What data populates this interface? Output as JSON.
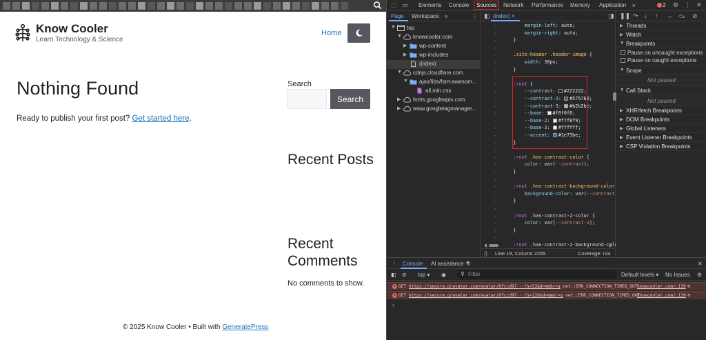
{
  "site": {
    "brand_title": "Know Cooler",
    "brand_tagline": "Learn Technology & Science",
    "nav_home": "Home",
    "page_title": "Nothing Found",
    "page_text": "Ready to publish your first post? ",
    "page_link": "Get started here",
    "page_text_end": ".",
    "search_label": "Search",
    "search_button": "Search",
    "recent_posts_title": "Recent Posts",
    "recent_comments_title": "Recent Comments",
    "no_comments": "No comments to show.",
    "footer_text": "© 2025 Know Cooler • Built with ",
    "footer_link": "GeneratePress"
  },
  "devtools": {
    "tabs": [
      "Elements",
      "Console",
      "Sources",
      "Network",
      "Performance",
      "Memory",
      "Application"
    ],
    "active_tab": "Sources",
    "more_tabs": "»",
    "error_count": "2",
    "navigator": {
      "tabs": [
        "Page",
        "Workspace"
      ],
      "more": "»",
      "tree": [
        {
          "label": "top",
          "type": "frame",
          "level": 0,
          "expanded": true
        },
        {
          "label": "knowcooler.com",
          "type": "cloud",
          "level": 1,
          "expanded": true
        },
        {
          "label": "wp-content",
          "type": "folder",
          "level": 2,
          "expanded": false
        },
        {
          "label": "wp-includes",
          "type": "folder",
          "level": 2,
          "expanded": false
        },
        {
          "label": "(index)",
          "type": "file",
          "level": 2,
          "selected": true
        },
        {
          "label": "cdnjs.cloudflare.com",
          "type": "cloud",
          "level": 1,
          "expanded": true
        },
        {
          "label": "ajax/libs/font-awesom...",
          "type": "folder",
          "level": 2,
          "expanded": true
        },
        {
          "label": "all.min.css",
          "type": "css",
          "level": 3
        },
        {
          "label": "fonts.googleapis.com",
          "type": "cloud",
          "level": 1,
          "expanded": false
        },
        {
          "label": "www.googletagmanager...",
          "type": "cloud",
          "level": 1,
          "expanded": false
        }
      ]
    },
    "editor": {
      "tab": "(index)",
      "status_position": "Line 19, Column 2265",
      "status_coverage": "Coverage: n/a",
      "code": [
        {
          "t": "        margin-left: auto;"
        },
        {
          "t": "        margin-right: auto;"
        },
        {
          "t": "    }"
        },
        {
          "t": ""
        },
        {
          "t": "    .site-header .header-image {"
        },
        {
          "t": "        width: 30px;"
        },
        {
          "t": "    }"
        },
        {
          "t": ""
        },
        {
          "t": "    :root {"
        },
        {
          "t": "        --contrast: ",
          "swatch": "#222222",
          "v": "#222222;"
        },
        {
          "t": "        --contrast-2: ",
          "swatch": "#575760",
          "v": "#575760;"
        },
        {
          "t": "        --contrast-3: ",
          "swatch": "#b2b2be",
          "v": "#b2b2be;"
        },
        {
          "t": "        --base: ",
          "swatch": "#f0f0f0",
          "v": "#f0f0f0;"
        },
        {
          "t": "        --base-2: ",
          "swatch": "#f7f8f9",
          "v": "#f7f8f9;"
        },
        {
          "t": "        --base-3: ",
          "swatch": "#ffffff",
          "v": "#ffffff;"
        },
        {
          "t": "        --accent: ",
          "swatch": "#1e73be",
          "v": "#1e73be;"
        },
        {
          "t": "    }"
        },
        {
          "t": ""
        },
        {
          "t": "    :root .has-contrast-color {"
        },
        {
          "t": "        color: var(--contrast);"
        },
        {
          "t": "    }"
        },
        {
          "t": ""
        },
        {
          "t": "    :root .has-contrast-background-color {"
        },
        {
          "t": "        background-color: var(--contrast);"
        },
        {
          "t": "    }"
        },
        {
          "t": ""
        },
        {
          "t": "    :root .has-contrast-2-color {"
        },
        {
          "t": "        color: var(--contrast-2);"
        },
        {
          "t": "    }"
        },
        {
          "t": ""
        },
        {
          "t": "    :root .has-contrast-2-background-color {"
        }
      ]
    },
    "debugger": {
      "sections": {
        "threads": "Threads",
        "watch": "Watch",
        "breakpoints": "Breakpoints",
        "pause_uncaught": "Pause on uncaught exceptions",
        "pause_caught": "Pause on caught exceptions",
        "scope": "Scope",
        "not_paused": "Not paused",
        "call_stack": "Call Stack",
        "xhr": "XHR/fetch Breakpoints",
        "dom": "DOM Breakpoints",
        "global": "Global Listeners",
        "event": "Event Listener Breakpoints",
        "csp": "CSP Violation Breakpoints"
      }
    },
    "console": {
      "tabs": [
        "Console",
        "AI assistance"
      ],
      "context": "top",
      "filter_placeholder": "Filter",
      "levels": "Default levels",
      "issues": "No Issues",
      "rows": [
        {
          "method": "GET",
          "url": "https://secure.gravatar.com/avatar/6fccd97···?s=52&d=mm&r=g",
          "error": "net::ERR_CONNECTION_TIMED_OUT",
          "source": "knowcooler.com/:139"
        },
        {
          "method": "GET",
          "url": "https://secure.gravatar.com/avatar/6fccd97···?s=128&d=mm&r=g",
          "error": "net::ERR_CONNECTION_TIMED_OUT",
          "source": "knowcooler.com/:139"
        }
      ]
    }
  }
}
